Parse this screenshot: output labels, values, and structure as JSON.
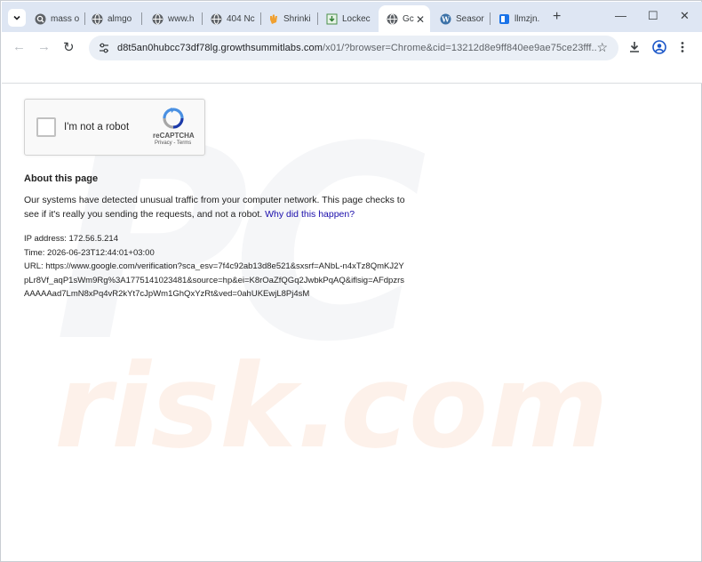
{
  "tabs": [
    {
      "label": "mass o",
      "icon": "search-tab-icon"
    },
    {
      "label": "almgo",
      "icon": "globe-icon"
    },
    {
      "label": "www.h",
      "icon": "globe-icon"
    },
    {
      "label": "404 Nc",
      "icon": "globe-icon"
    },
    {
      "label": "Shrinki",
      "icon": "hand-icon"
    },
    {
      "label": "Lockec",
      "icon": "download-lock-icon"
    },
    {
      "label": "Gc",
      "icon": "globe-icon",
      "active": true
    },
    {
      "label": "Seasor",
      "icon": "wordpress-icon"
    },
    {
      "label": "llmzjn.",
      "icon": "blue-square-icon"
    }
  ],
  "active_tab_close": "✕",
  "new_tab": "+",
  "window_controls": {
    "minimize": "—",
    "maximize": "☐",
    "close": "✕"
  },
  "toolbar": {
    "back": "←",
    "forward": "→",
    "reload": "↻",
    "url_host": "d8t5an0hubcc73df78lg.growthsummitlabs.com",
    "url_path": "/x01/?browser=Chrome&cid=13212d8e9ff840ee9ae75ce23fff...",
    "star": "☆"
  },
  "captcha": {
    "label": "I'm not a robot",
    "brand": "reCAPTCHA",
    "links": "Privacy - Terms"
  },
  "page": {
    "heading": "About this page",
    "description": "Our systems have detected unusual traffic from your computer network. This page checks to see if it's really you sending the requests, and not a robot.",
    "link": "Why did this happen?",
    "ip_line": "IP address: 172.56.5.214",
    "time_line": "Time: 2026-06-23T12:44:01+03:00",
    "url_line": "URL: https://www.google.com/verification?sca_esv=7f4c92ab13d8e521&sxsrf=ANbL-n4xTz8QmKJ2YpLr8Vf_aqP1sWm9Rg%3A1775141023481&source=hp&ei=K8rOaZfQGq2JwbkPqAQ&iflsig=AFdpzrsAAAAAad7LmN8xPq4vR2kYt7cJpWm1GhQxYzRt&ved=0ahUKEwjL8Pj4sM"
  },
  "watermark": {
    "logo": "PC",
    "text": "risk.com"
  }
}
